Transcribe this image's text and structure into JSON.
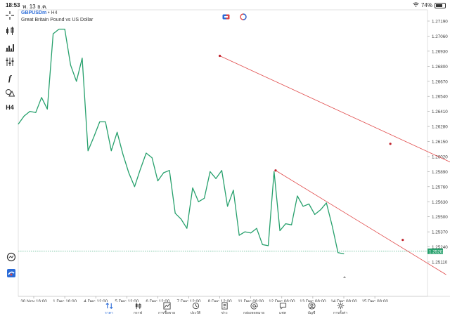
{
  "status": {
    "time": "18:53",
    "date": "พ. 13 ธ.ค.",
    "battery": "74%"
  },
  "symbol": {
    "name": "GBPUSDm",
    "timeframe": "• H4",
    "description": "Great Britain Pound vs US Dollar"
  },
  "toolbar": [
    {
      "name": "crosshair",
      "icon": "crosshair-icon"
    },
    {
      "name": "candles",
      "icon": "candlestick-icon"
    },
    {
      "name": "volumes",
      "icon": "volume-bars-icon"
    },
    {
      "name": "indicators",
      "icon": "indicators-icon"
    },
    {
      "name": "functions",
      "icon": "function-icon",
      "text": "f"
    },
    {
      "name": "objects",
      "icon": "shapes-icon"
    },
    {
      "name": "timeframe",
      "text": "H4"
    }
  ],
  "chart_data": {
    "type": "line",
    "series_color": "#26a06c",
    "price_levels": [
      "1.27190",
      "1.27060",
      "1.26930",
      "1.26800",
      "1.26670",
      "1.26540",
      "1.26410",
      "1.26280",
      "1.26150",
      "1.26020",
      "1.25890",
      "1.25760",
      "1.25630",
      "1.25500",
      "1.25370",
      "1.25240",
      "1.25110"
    ],
    "current_price": "1.25202",
    "time_labels": [
      "30 Nov 16:00",
      "1 Dec 16:00",
      "4 Dec 12:00",
      "5 Dec 12:00",
      "6 Dec 12:00",
      "7 Dec 12:00",
      "8 Dec 12:00",
      "11 Dec 08:00",
      "12 Dec 08:00",
      "13 Dec 08:00",
      "14 Dec 08:00",
      "15 Dec 08:00"
    ],
    "values": [
      1.263,
      1.2637,
      1.2641,
      1.264,
      1.2653,
      1.2643,
      1.2708,
      1.2712,
      1.2712,
      1.2681,
      1.2667,
      1.2687,
      1.2607,
      1.2619,
      1.2632,
      1.2632,
      1.2607,
      1.2623,
      1.2604,
      1.2588,
      1.2576,
      1.2591,
      1.2605,
      1.2601,
      1.2581,
      1.2588,
      1.259,
      1.2553,
      1.2548,
      1.254,
      1.2575,
      1.2563,
      1.2566,
      1.2589,
      1.2583,
      1.259,
      1.2559,
      1.2573,
      1.2534,
      1.2537,
      1.2536,
      1.254,
      1.2526,
      1.2525,
      1.2589,
      1.2538,
      1.2544,
      1.2543,
      1.2568,
      1.2559,
      1.2561,
      1.2552,
      1.2556,
      1.2562,
      1.2542,
      1.2519,
      1.2518
    ],
    "trendlines": [
      {
        "from": [
          6,
          1.2689
        ],
        "to": [
          17.5,
          1.2547
        ],
        "mid": [
          11.5,
          1.2613
        ]
      },
      {
        "from": [
          7.8,
          1.259
        ],
        "to": [
          13.3,
          1.25
        ],
        "mid": [
          11.9,
          1.253
        ]
      }
    ],
    "trendline_color": "#e04848"
  },
  "right_icons": [
    "alert-icon",
    "app-logo-icon"
  ],
  "tabs": [
    {
      "label": "ราคา",
      "icon": "quotes-icon",
      "active": true
    },
    {
      "label": "กราฟ",
      "icon": "chart-icon"
    },
    {
      "label": "การซื้อขาย",
      "icon": "trade-icon"
    },
    {
      "label": "ประวัติ",
      "icon": "history-icon"
    },
    {
      "label": "ข่าว",
      "icon": "news-icon"
    },
    {
      "label": "กล่องจดหมาย",
      "icon": "mailbox-icon"
    },
    {
      "label": "แชท",
      "icon": "chat-icon"
    },
    {
      "label": "บัญชี",
      "icon": "account-icon"
    },
    {
      "label": "การตั้งค่า",
      "icon": "settings-icon"
    }
  ]
}
